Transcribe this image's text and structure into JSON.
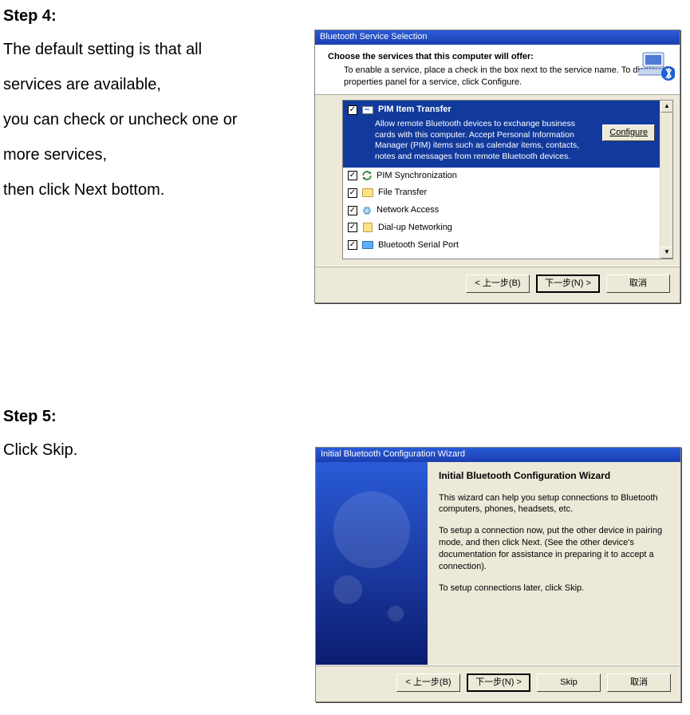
{
  "step4": {
    "heading": "Step 4:",
    "line1": "The default setting is that all",
    "line2": "services are available,",
    "line3": "you can check or uncheck one or",
    "line4": "more services,",
    "line5": "then click Next bottom."
  },
  "step5": {
    "heading": "Step 5:",
    "line1": "Click Skip."
  },
  "dialog1": {
    "title": "Bluetooth Service Selection",
    "header_title": "Choose the services that this computer will offer:",
    "header_sub": "To enable a service, place a check in the box next to the service name.\nTo display the properties panel for a service, click Configure.",
    "configure_label": "Configure",
    "services": [
      {
        "name": "PIM Item Transfer",
        "checked": true,
        "highlighted": true,
        "desc": "Allow remote Bluetooth devices to exchange business cards with this computer. Accept Personal Information Manager (PIM) items such as calendar items, contacts, notes and messages from remote Bluetooth devices."
      },
      {
        "name": "PIM Synchronization",
        "checked": true
      },
      {
        "name": "File Transfer",
        "checked": true
      },
      {
        "name": "Network Access",
        "checked": true
      },
      {
        "name": "Dial-up Networking",
        "checked": true
      },
      {
        "name": "Bluetooth Serial Port",
        "checked": true
      }
    ],
    "buttons": {
      "back": "< 上一步(B)",
      "next": "下一步(N) >",
      "cancel": "取消"
    }
  },
  "dialog2": {
    "title": "Initial Bluetooth Configuration Wizard",
    "body_title": "Initial Bluetooth Configuration Wizard",
    "p1": "This wizard can help you setup connections to Bluetooth computers, phones, headsets, etc.",
    "p2": "To setup a connection now, put the other device in pairing mode, and then click Next.\n(See the other device's documentation for assistance in preparing it to accept a connection).",
    "p3": "To setup connections later, click Skip.",
    "buttons": {
      "back": "< 上一步(B)",
      "next": "下一步(N) >",
      "skip": "Skip",
      "cancel": "取消"
    }
  }
}
